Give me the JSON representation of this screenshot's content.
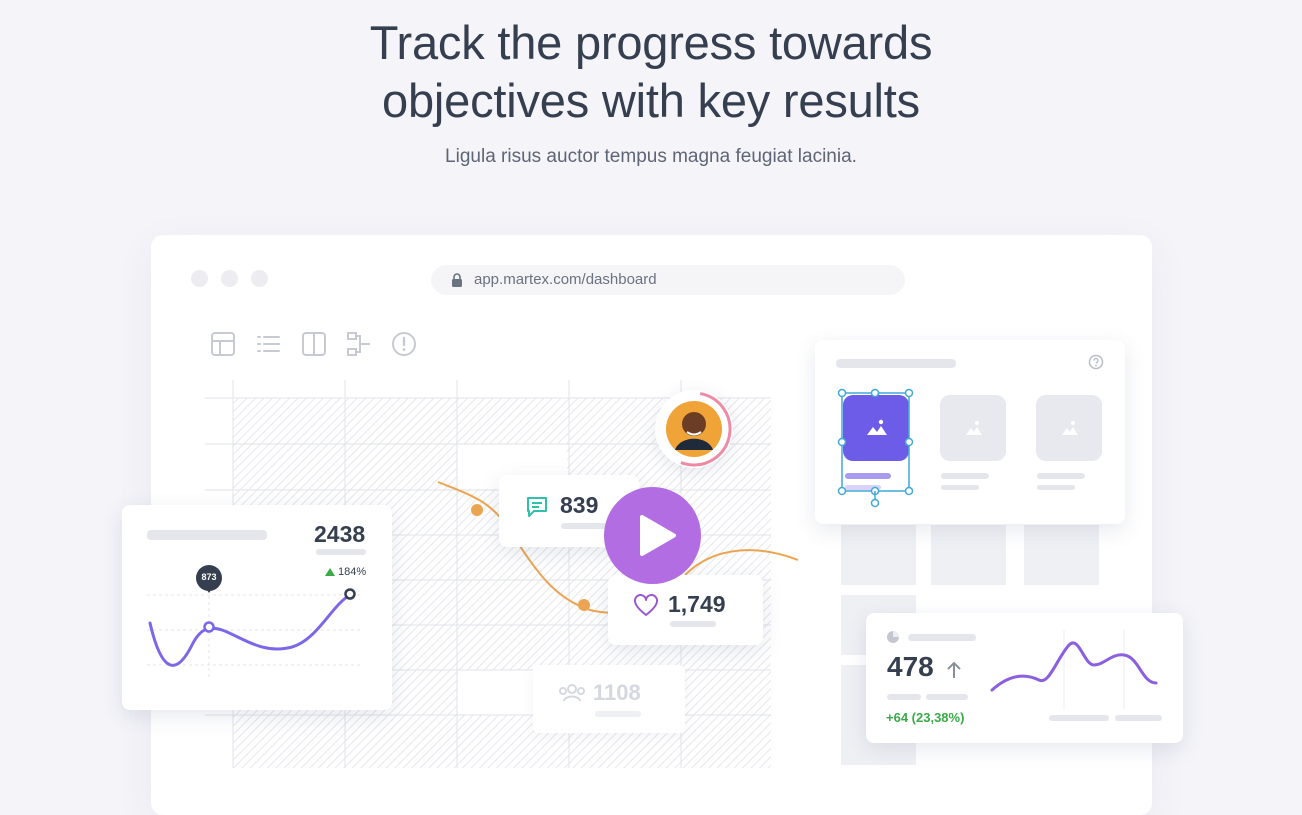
{
  "hero": {
    "title_line1": "Track the progress towards",
    "title_line2": "objectives with key results",
    "subtitle": "Ligula risus auctor tempus magna feugiat lacinia."
  },
  "browser": {
    "url": "app.martex.com/dashboard"
  },
  "toolbar_icons": [
    "table-icon",
    "list-icon",
    "columns-icon",
    "hierarchy-icon",
    "alert-icon"
  ],
  "stat_card_left": {
    "value": "2438",
    "change": "184%",
    "marker_value": "873"
  },
  "comments_card": {
    "value": "839"
  },
  "likes_card": {
    "value": "1,749"
  },
  "users_card": {
    "value": "1108"
  },
  "stat_card_right": {
    "value": "478",
    "change": "+64 (23,38%)"
  },
  "colors": {
    "accent_purple": "#7b68e8",
    "play_purple": "#b36de3",
    "orange": "#eba552",
    "green": "#3aaa48",
    "teal": "#2fbfab"
  }
}
